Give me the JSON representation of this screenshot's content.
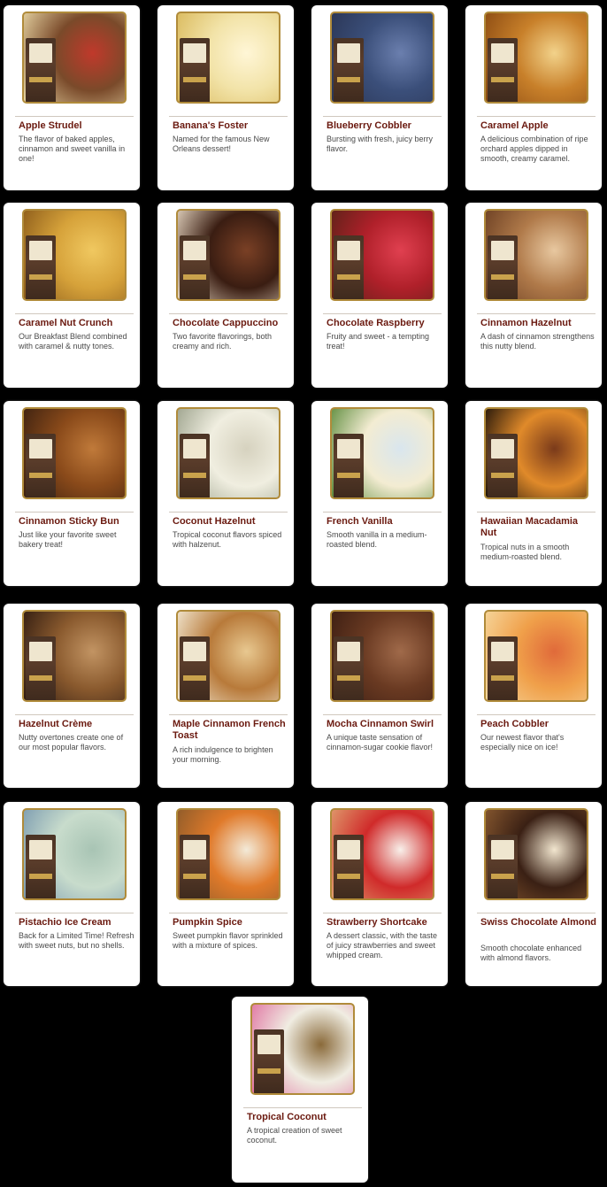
{
  "flavors": [
    {
      "name": "Apple Strudel",
      "description": "The flavor of baked apples, cinnamon and sweet vanilla in one!",
      "image": "apples-cinnamon-photo",
      "colors": [
        "#7a4a2a",
        "#c0392b",
        "#e9d8a6"
      ]
    },
    {
      "name": "Banana's Foster",
      "description": "Named for the famous New Orleans dessert!",
      "image": "banana-slices-photo",
      "colors": [
        "#f2e3a8",
        "#fff6d6",
        "#d9b85a"
      ]
    },
    {
      "name": "Blueberry Cobbler",
      "description": "Bursting with fresh, juicy berry flavor.",
      "image": "blueberries-photo",
      "colors": [
        "#3b4f7a",
        "#6b7fae",
        "#2a3554"
      ]
    },
    {
      "name": "Caramel Apple",
      "description": "A delicious combination of ripe orchard apples dipped in smooth, creamy caramel.",
      "image": "caramel-apple-photo",
      "colors": [
        "#c8802a",
        "#f2d28a",
        "#8a4a12"
      ]
    },
    {
      "name": "Caramel Nut Crunch",
      "description": "Our Breakfast Blend combined with caramel & nutty tones.",
      "image": "caramel-nuts-photo",
      "colors": [
        "#d6a23a",
        "#f0c860",
        "#8a5a1a"
      ]
    },
    {
      "name": "Chocolate Cappuccino",
      "description": "Two favorite flavorings, both creamy and rich.",
      "image": "chocolates-photo",
      "colors": [
        "#3a1d12",
        "#7a4025",
        "#e8d9c4"
      ]
    },
    {
      "name": "Chocolate Raspberry",
      "description": "Fruity and sweet - a tempting treat!",
      "image": "raspberries-photo",
      "colors": [
        "#b0202a",
        "#e04050",
        "#5a2218"
      ]
    },
    {
      "name": "Cinnamon Hazelnut",
      "description": "A dash of cinnamon strengthens this nutty blend.",
      "image": "cinnamon-stick-photo",
      "colors": [
        "#b07a4a",
        "#e8c8a0",
        "#6a3e22"
      ]
    },
    {
      "name": "Cinnamon Sticky Bun",
      "description": "Just like your favorite sweet bakery treat!",
      "image": "sticky-bun-photo",
      "colors": [
        "#8a4a1a",
        "#c07a3a",
        "#3a2010"
      ]
    },
    {
      "name": "Coconut Hazelnut",
      "description": "Tropical coconut flavors spiced with halzenut.",
      "image": "ice-cream-photo",
      "colors": [
        "#f0eee0",
        "#d6d2bf",
        "#9aa08a"
      ]
    },
    {
      "name": "French Vanilla",
      "description": "Smooth vanilla in a medium-roasted blend.",
      "image": "vanilla-ice-cream-photo",
      "colors": [
        "#f3ecd2",
        "#d9e6ee",
        "#5a8a3a"
      ]
    },
    {
      "name": "Hawaiian Macadamia Nut",
      "description": "Tropical nuts in a smooth medium-roasted blend.",
      "image": "palm-sunset-photo",
      "colors": [
        "#e08a2a",
        "#7a3a1a",
        "#1a1008"
      ]
    },
    {
      "name": "Hazelnut Crème",
      "description": "Nutty overtones create one of our most popular flavors.",
      "image": "chocolate-tart-photo",
      "colors": [
        "#8a5a2e",
        "#c29463",
        "#2e1a10"
      ]
    },
    {
      "name": "Maple Cinnamon French Toast",
      "description": "A rich indulgence to brighten your morning.",
      "image": "french-toast-photo",
      "colors": [
        "#b87a3a",
        "#e8c890",
        "#f4ecd8"
      ]
    },
    {
      "name": "Mocha Cinnamon Swirl",
      "description": "A unique taste sensation of cinnamon-sugar cookie flavor!",
      "image": "cinnamon-chocolate-photo",
      "colors": [
        "#6a3a22",
        "#a06a4a",
        "#3a1d12"
      ]
    },
    {
      "name": "Peach Cobbler",
      "description": "Our newest flavor that's especially nice on ice!",
      "image": "peach-photo",
      "colors": [
        "#f0a04a",
        "#e06a3a",
        "#f6d9a0"
      ]
    },
    {
      "name": "Pistachio Ice Cream",
      "description": "Back for a Limited Time! Refresh with sweet nuts, but no shells.",
      "image": "pistachio-ice-cream-photo",
      "colors": [
        "#c8dccc",
        "#a8c4b4",
        "#7a9ab0"
      ]
    },
    {
      "name": "Pumpkin Spice",
      "description": "Sweet pumpkin flavor sprinkled with a mixture of spices.",
      "image": "pumpkins-photo",
      "colors": [
        "#e07a2a",
        "#f3ead8",
        "#8a5a2a"
      ]
    },
    {
      "name": "Strawberry Shortcake",
      "description": "A dessert classic, with the taste of juicy strawberries and sweet whipped cream.",
      "image": "strawberry-shortcake-photo",
      "colors": [
        "#d02a2a",
        "#f8f0ea",
        "#e0a070"
      ]
    },
    {
      "name": "Swiss Chocolate Almond",
      "description": "Smooth chocolate enhanced with almond flavors.",
      "image": "chocolate-almond-photo",
      "colors": [
        "#3a2014",
        "#f2e6cf",
        "#8a5a30"
      ]
    },
    {
      "name": "Tropical Coconut",
      "description": "A tropical creation of sweet coconut.",
      "image": "coconut-flower-photo",
      "colors": [
        "#f0ede2",
        "#8a6a3a",
        "#e070a0"
      ]
    }
  ]
}
